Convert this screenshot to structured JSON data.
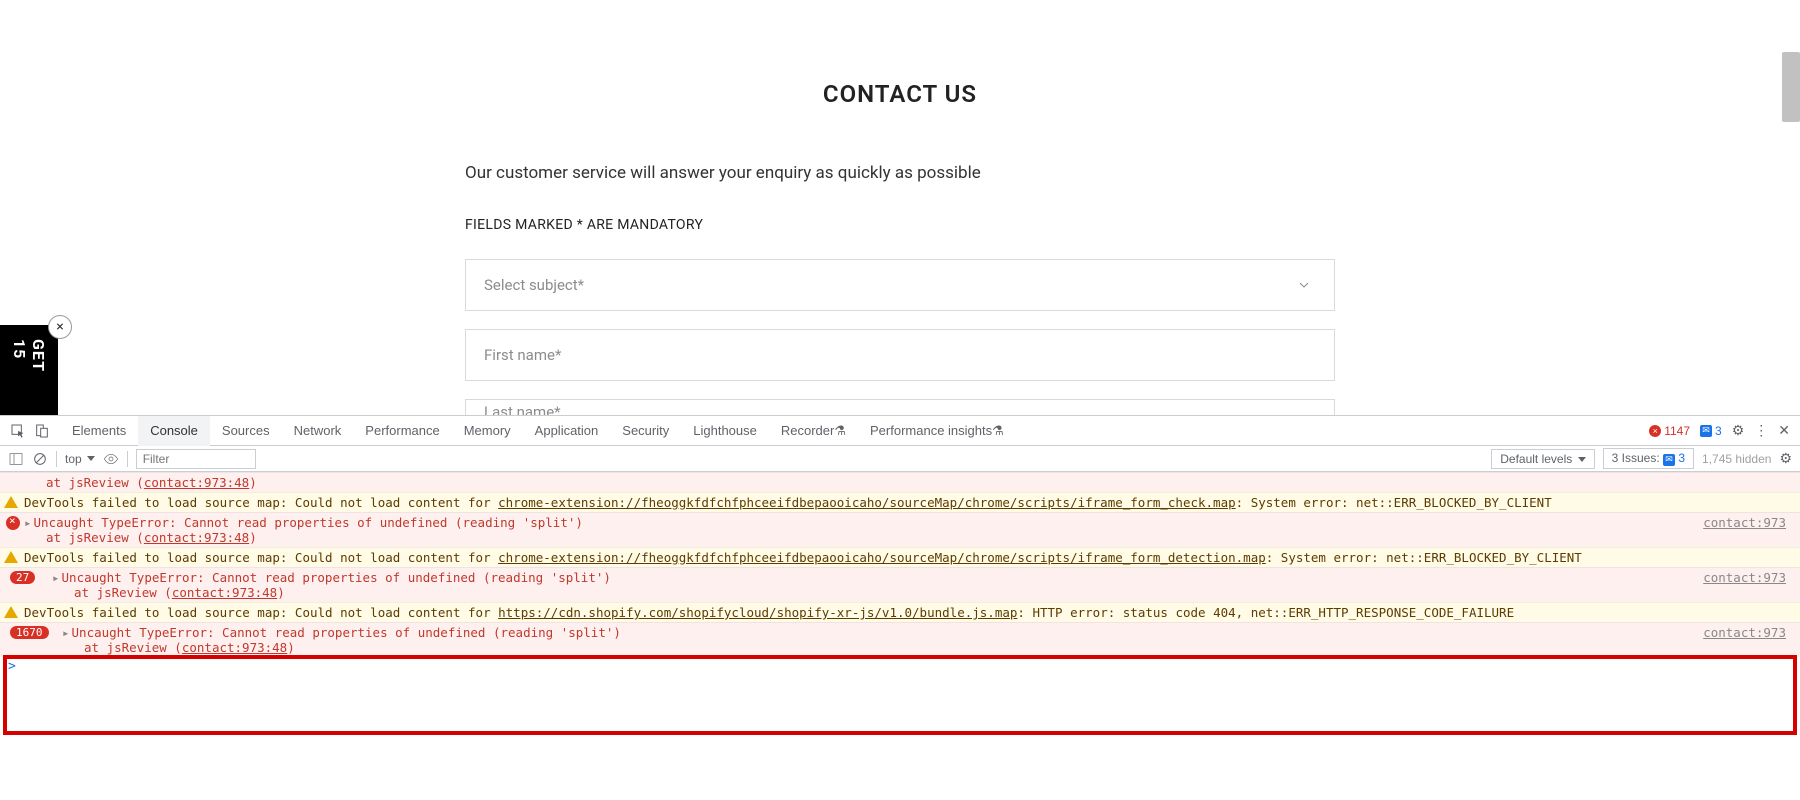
{
  "page": {
    "title": "CONTACT US",
    "subtitle": "Our customer service will answer your enquiry as quickly as possible",
    "mandatory_note": "FIELDS MARKED * ARE MANDATORY",
    "subject_placeholder": "Select subject*",
    "first_name_placeholder": "First name*",
    "last_name_placeholder": "Last name*",
    "widget_text": "GET 15",
    "widget_close": "×"
  },
  "devtools": {
    "tabs": {
      "elements": "Elements",
      "console": "Console",
      "sources": "Sources",
      "network": "Network",
      "performance": "Performance",
      "memory": "Memory",
      "application": "Application",
      "security": "Security",
      "lighthouse": "Lighthouse",
      "recorder": "Recorder",
      "perf_insights": "Performance insights"
    },
    "header_right": {
      "error_count": "1147",
      "msg_count": "3"
    },
    "toolbar": {
      "top": "top",
      "filter_placeholder": "Filter",
      "default_levels": "Default levels",
      "issues_label": "3 Issues:",
      "issues_count": "3",
      "hidden": "1,745 hidden"
    },
    "log": {
      "row0_stack": "at jsReview (",
      "row0_link": "contact:973:48",
      "row0_stack2": ")",
      "row1_text": "DevTools failed to load source map: Could not load content for ",
      "row1_url": "chrome-extension://fheoggkfdfchfphceeifdbepaooicaho/sourceMap/chrome/scripts/iframe_form_check.map",
      "row1_tail": ": System error: net::ERR_BLOCKED_BY_CLIENT",
      "row2_text": "Uncaught TypeError: Cannot read properties of undefined (reading 'split')",
      "row2_src": "contact:973",
      "row2_stack": "at jsReview (",
      "row2_link": "contact:973:48",
      "row2_stack2": ")",
      "row3_text": "DevTools failed to load source map: Could not load content for ",
      "row3_url": "chrome-extension://fheoggkfdfchfphceeifdbepaooicaho/sourceMap/chrome/scripts/iframe_form_detection.map",
      "row3_tail": ": System error: net::ERR_BLOCKED_BY_CLIENT",
      "row4_badge": "27",
      "row4_text": "Uncaught TypeError: Cannot read properties of undefined (reading 'split')",
      "row4_src": "contact:973",
      "row4_stack": "at jsReview (",
      "row4_link": "contact:973:48",
      "row4_stack2": ")",
      "row5_text": "DevTools failed to load source map: Could not load content for ",
      "row5_url": "https://cdn.shopify.com/shopifycloud/shopify-xr-js/v1.0/bundle.js.map",
      "row5_tail": ": HTTP error: status code 404, net::ERR_HTTP_RESPONSE_CODE_FAILURE",
      "row6_badge": "1670",
      "row6_text": "Uncaught TypeError: Cannot read properties of undefined (reading 'split')",
      "row6_src": "contact:973",
      "row6_stack": "at jsReview (",
      "row6_link": "contact:973:48",
      "row6_stack2": ")",
      "prompt": ">"
    }
  }
}
